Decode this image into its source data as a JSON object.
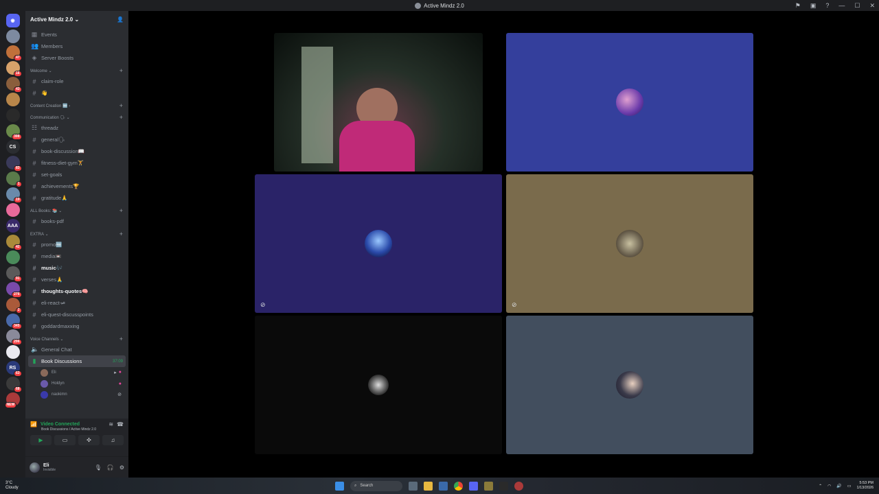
{
  "window": {
    "title": "Active Mindz 2.0"
  },
  "guilds": [
    {
      "label": "",
      "color": "#7d8aa0",
      "badge": ""
    },
    {
      "label": "",
      "color": "#c0703a",
      "badge": "47"
    },
    {
      "label": "",
      "color": "#d8a26a",
      "badge": "16"
    },
    {
      "label": "",
      "color": "#8a5e3c",
      "badge": "43"
    },
    {
      "label": "",
      "color": "#b8864a",
      "badge": ""
    },
    {
      "label": "",
      "color": "#2a2a2a",
      "badge": ""
    },
    {
      "label": "",
      "color": "#6a8a4a",
      "badge": "398"
    },
    {
      "label": "CS",
      "color": "#2b2d31",
      "badge": ""
    },
    {
      "label": "",
      "color": "#3a3a5a",
      "badge": "83"
    },
    {
      "label": "",
      "color": "#5a7a4a",
      "badge": "1"
    },
    {
      "label": "",
      "color": "#6a8aaa",
      "badge": "19"
    },
    {
      "label": "",
      "color": "#e86a9a",
      "badge": ""
    },
    {
      "label": "AAA",
      "color": "#3a2a6a",
      "badge": ""
    },
    {
      "label": "",
      "color": "#aa8a3a",
      "badge": "42"
    },
    {
      "label": "",
      "color": "#4a8a5a",
      "badge": ""
    },
    {
      "label": "",
      "color": "#5a5a5a",
      "badge": "91"
    },
    {
      "label": "",
      "color": "#7a4aaa",
      "badge": "276"
    },
    {
      "label": "",
      "color": "#aa5a3a",
      "badge": "2"
    },
    {
      "label": "",
      "color": "#4a6aaa",
      "badge": "345"
    },
    {
      "label": "",
      "color": "#8a8a9a",
      "badge": "296"
    },
    {
      "label": "",
      "color": "#eaeaf0",
      "badge": ""
    },
    {
      "label": "RS",
      "color": "#2a3a7a",
      "badge": "63"
    },
    {
      "label": "",
      "color": "#3a3a3a",
      "badge": "68"
    },
    {
      "label": "",
      "color": "#aa3a3a",
      "badge": "NEW"
    }
  ],
  "server": {
    "name": "Active Mindz 2.0",
    "top_items": [
      {
        "icon": "calendar-icon",
        "label": "Events"
      },
      {
        "icon": "members-icon",
        "label": "Members"
      },
      {
        "icon": "boost-icon",
        "label": "Server Boosts"
      }
    ],
    "cat_welcome": "Welcome",
    "ch_claim_role": "claim-role",
    "ch_emoji": "👋",
    "cat_content": "Content Creation 🆕",
    "cat_communication": "Communication 🗣",
    "ch_threadz": "threadz",
    "ch_general": "general🗣",
    "ch_book_discussion": "book-discussion📖",
    "ch_fitness": "fitness-diet-gym🏋",
    "ch_set_goals": "set-goals",
    "ch_achievements": "achievements🏆",
    "ch_gratitude": "gratitude🙏",
    "cat_all_books": "ALL Books: 📚",
    "ch_books_pdf": "books-pdf",
    "cat_extra": "EXTRA",
    "ch_promo": "promo🆓",
    "ch_media": "media📼",
    "ch_music": "music🎶",
    "ch_verses": "verses🙏",
    "ch_thoughts": "thoughts-quotes🧠",
    "ch_eli_react": "eli-react-⏯",
    "ch_eli_quest": "eli-quest-discusspoints",
    "ch_goddard": "goddardmaxxing",
    "cat_voice": "Voice Channels",
    "ch_general_chat": "General Chat",
    "ch_book_discussions": "Book Discussions",
    "vc_timer": "37:09",
    "vc_users": [
      {
        "name": "Eli",
        "color": "#8a6a5a"
      },
      {
        "name": "Holdyn",
        "color": "#6a5aaa"
      },
      {
        "name": "naokimn",
        "color": "#3a3aaa"
      }
    ]
  },
  "voice_panel": {
    "status": "Video Connected",
    "channel": "Book Discussions / Active Mindz 2.0"
  },
  "user": {
    "name": "Eli",
    "status": "Invisible"
  },
  "tiles_colors": [
    "#343f9c",
    "#2a2368",
    "#7a6b4c",
    "#0a0a0a",
    "#424e5e"
  ],
  "taskbar": {
    "temp": "3°C",
    "weather": "Cloudy",
    "search": "Search",
    "time": "5:53 PM",
    "date": "1/13/2026"
  }
}
